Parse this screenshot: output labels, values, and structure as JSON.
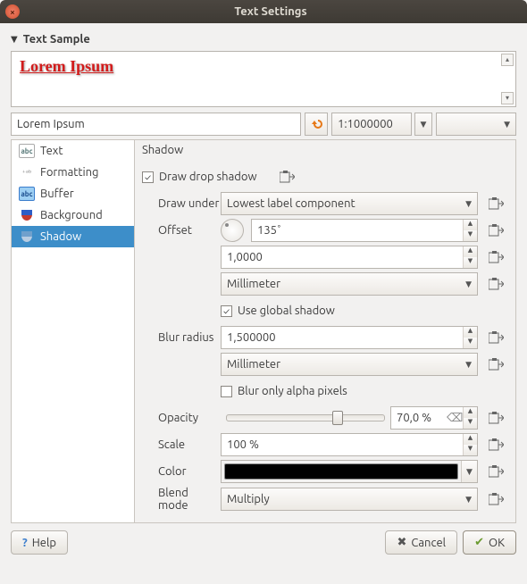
{
  "window": {
    "title": "Text Settings"
  },
  "sample": {
    "header": "Text Sample",
    "text": "Lorem Ipsum"
  },
  "input": {
    "value": "Lorem Ipsum"
  },
  "null_combo": {
    "value": ""
  },
  "scale_combo": {
    "value": "1:1000000"
  },
  "tabs": {
    "items": [
      {
        "label": "Text"
      },
      {
        "label": "Formatting"
      },
      {
        "label": "Buffer"
      },
      {
        "label": "Background"
      },
      {
        "label": "Shadow"
      }
    ]
  },
  "panel": {
    "title": "Shadow",
    "draw_checkbox": "Draw drop shadow",
    "labels": {
      "draw_under": "Draw under",
      "offset": "Offset",
      "blur_radius": "Blur radius",
      "opacity": "Opacity",
      "scale": "Scale",
      "color": "Color",
      "blend_mode": "Blend mode"
    },
    "draw_under": {
      "value": "Lowest label component"
    },
    "offset": {
      "angle": "135˚",
      "distance": "1,0000",
      "unit": "Millimeter",
      "use_global": "Use global shadow"
    },
    "blur": {
      "value": "1,500000",
      "unit": "Millimeter",
      "alpha_only": "Blur only alpha pixels"
    },
    "opacity": {
      "value": "70,0 %"
    },
    "scale": {
      "value": "100 %"
    },
    "color": {
      "value": "#000000"
    },
    "blend": {
      "value": "Multiply"
    }
  },
  "footer": {
    "help": "Help",
    "cancel": "Cancel",
    "ok": "OK"
  }
}
